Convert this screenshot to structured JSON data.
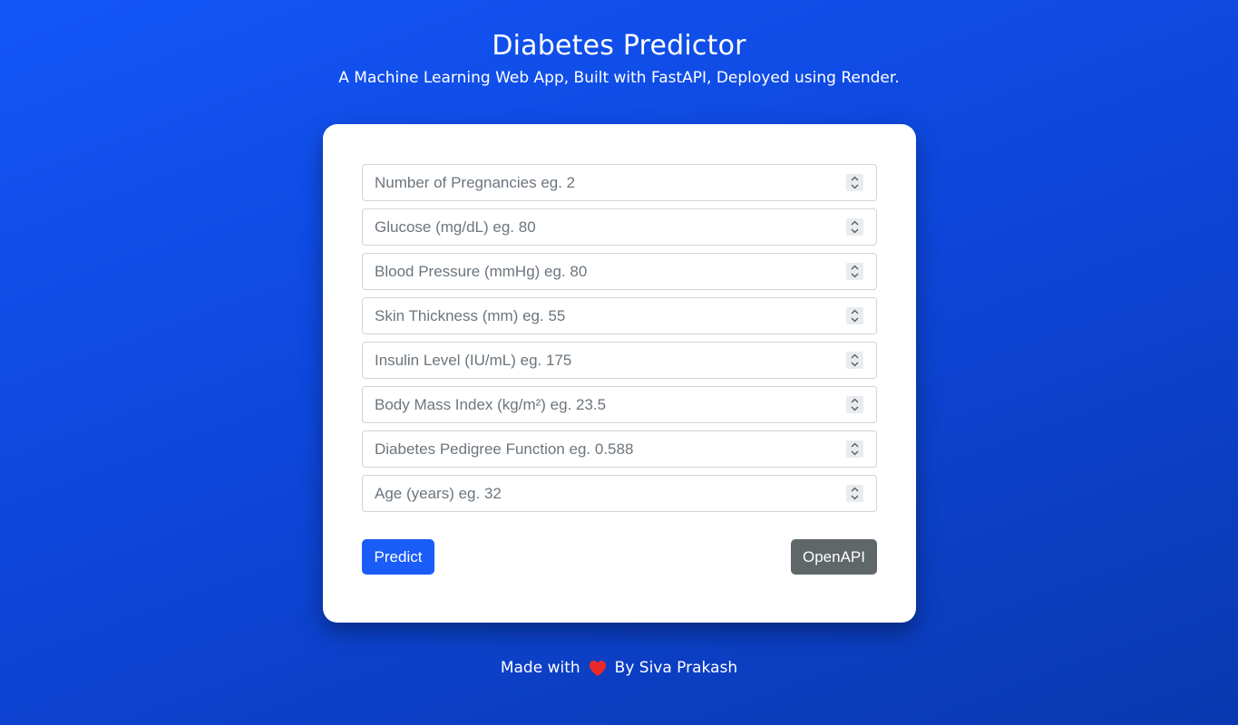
{
  "header": {
    "title": "Diabetes Predictor",
    "subtitle": "A Machine Learning Web App, Built with FastAPI, Deployed using Render."
  },
  "form": {
    "fields": [
      {
        "placeholder": "Number of Pregnancies eg. 2",
        "value": ""
      },
      {
        "placeholder": "Glucose (mg/dL) eg. 80",
        "value": ""
      },
      {
        "placeholder": "Blood Pressure (mmHg) eg. 80",
        "value": ""
      },
      {
        "placeholder": "Skin Thickness (mm) eg. 55",
        "value": ""
      },
      {
        "placeholder": "Insulin Level (IU/mL) eg. 175",
        "value": ""
      },
      {
        "placeholder": "Body Mass Index (kg/m²) eg. 23.5",
        "value": ""
      },
      {
        "placeholder": "Diabetes Pedigree Function eg. 0.588",
        "value": ""
      },
      {
        "placeholder": "Age (years) eg. 32",
        "value": ""
      }
    ],
    "predict_label": "Predict",
    "openapi_label": "OpenAPI"
  },
  "footer": {
    "made_with": "Made with",
    "heart_icon": "heart-icon",
    "author": "By Siva Prakash"
  },
  "colors": {
    "background": "#1456f8",
    "primary_button": "#1a5cf8",
    "secondary_button": "#5f6769",
    "heart": "#ea2a2a"
  }
}
